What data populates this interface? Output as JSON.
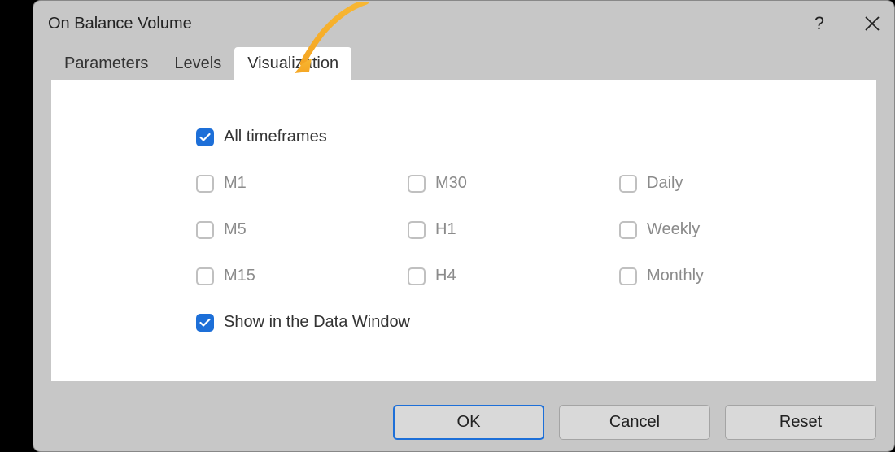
{
  "dialog": {
    "title": "On Balance Volume"
  },
  "tabs": {
    "parameters": "Parameters",
    "levels": "Levels",
    "visualization": "Visualization"
  },
  "checkboxes": {
    "all_timeframes": "All timeframes",
    "m1": "M1",
    "m5": "M5",
    "m15": "M15",
    "m30": "M30",
    "h1": "H1",
    "h4": "H4",
    "daily": "Daily",
    "weekly": "Weekly",
    "monthly": "Monthly",
    "show_data_window": "Show in the Data Window"
  },
  "buttons": {
    "ok": "OK",
    "cancel": "Cancel",
    "reset": "Reset"
  }
}
